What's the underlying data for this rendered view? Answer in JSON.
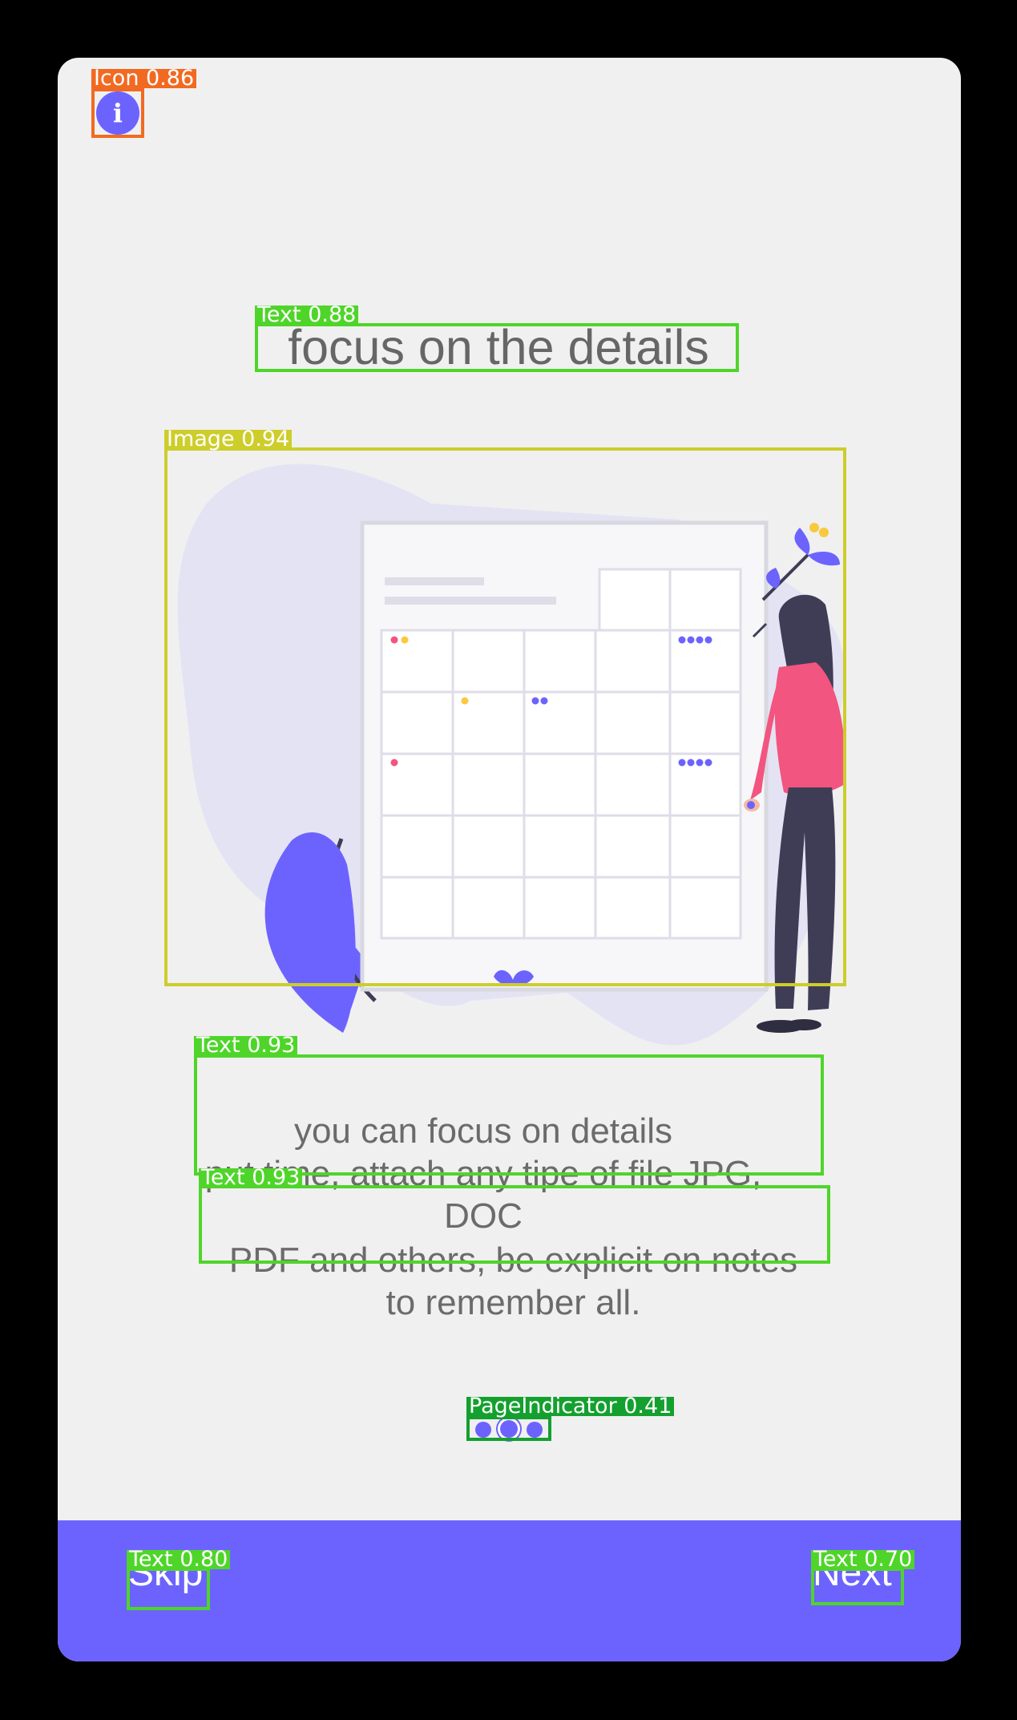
{
  "screen": {
    "title": "focus on the details",
    "description_line_1": "you can focus on details",
    "description_line_2": "put time, attach any tipe of file JPG,",
    "description_line_3": "DOC",
    "description_line_4": "PDF and others, be explicit on notes",
    "description_line_5": "to remember all."
  },
  "pager": {
    "total": 3,
    "active_index": 1
  },
  "bottom_bar": {
    "skip_label": "Skip",
    "next_label": "Next"
  },
  "icons": {
    "info": "info-icon"
  },
  "colors": {
    "accent": "#6c63ff",
    "background": "#f0f0f0",
    "text": "#666666"
  },
  "detections": {
    "icon": "Icon 0.86",
    "title": "Text 0.88",
    "image": "Image 0.94",
    "desc1": "Text 0.93",
    "desc2": "Text 0.93",
    "pager": "PageIndicator 0.41",
    "skip": "Text 0.80",
    "next": "Text 0.70"
  }
}
